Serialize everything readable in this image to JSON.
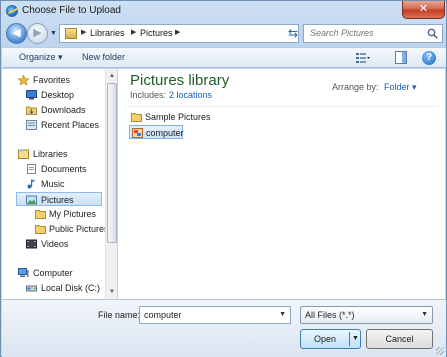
{
  "window": {
    "title": "Choose File to Upload",
    "close_label": "✕"
  },
  "nav": {
    "address_segments": [
      "Libraries",
      "Pictures"
    ],
    "search_placeholder": "Search Pictures"
  },
  "toolbar": {
    "organize_label": "Organize ▾",
    "new_folder_label": "New folder"
  },
  "sidebar": {
    "items": [
      {
        "label": "Favorites",
        "icon": "star-icon"
      },
      {
        "label": "Desktop",
        "icon": "desktop-icon"
      },
      {
        "label": "Downloads",
        "icon": "downloads-icon"
      },
      {
        "label": "Recent Places",
        "icon": "recent-places-icon"
      },
      {
        "label": "Libraries",
        "icon": "libraries-icon"
      },
      {
        "label": "Documents",
        "icon": "documents-icon"
      },
      {
        "label": "Music",
        "icon": "music-icon"
      },
      {
        "label": "Pictures",
        "icon": "pictures-icon",
        "selected": true
      },
      {
        "label": "My Pictures",
        "icon": "folder-icon"
      },
      {
        "label": "Public Pictures",
        "icon": "folder-icon"
      },
      {
        "label": "Videos",
        "icon": "videos-icon"
      },
      {
        "label": "Computer",
        "icon": "computer-icon"
      },
      {
        "label": "Local Disk (C:)",
        "icon": "disk-icon"
      }
    ]
  },
  "main": {
    "title": "Pictures library",
    "includes_label": "Includes:",
    "includes_link": "2 locations",
    "arrange_label": "Arrange by:",
    "arrange_value": "Folder ▾",
    "files": [
      {
        "label": "Sample Pictures",
        "icon": "folder-icon"
      },
      {
        "label": "computer",
        "icon": "image-file-icon",
        "selected": true
      }
    ]
  },
  "footer": {
    "file_name_label": "File name:",
    "file_name_value": "computer",
    "file_type_value": "All Files (*.*)",
    "open_label": "Open",
    "cancel_label": "Cancel"
  },
  "colors": {
    "accent": "#1c5bb4",
    "library_title": "#1e5e2a",
    "selection": "#cde3f8"
  }
}
